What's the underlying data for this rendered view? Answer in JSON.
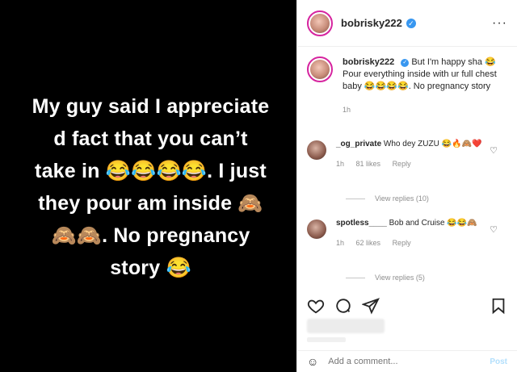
{
  "story": {
    "lines": [
      "My guy said I appreciate",
      "d fact that you can’t",
      "take in 😂😂😂😂. I just",
      "they pour am inside 🙈",
      "🙈🙈. No pregnancy",
      "story 😂"
    ]
  },
  "header": {
    "username": "bobrisky222",
    "verified_icon": "verified-badge-icon",
    "more_label": "···"
  },
  "caption": {
    "username": "bobrisky222",
    "text": "But I'm happy sha 😂 Pour everything inside with ur full chest baby 😂😂😂😂. No pregnancy story",
    "time": "1h"
  },
  "comments": [
    {
      "username": "_og_private",
      "text": "Who dey ZUZU 😂🔥🙈❤️",
      "time": "1h",
      "likes": "81 likes",
      "reply": "Reply",
      "view_replies": "View replies (10)"
    },
    {
      "username": "spotless____",
      "text": "Bob and Cruise 😂😂🙈",
      "time": "1h",
      "likes": "62 likes",
      "reply": "Reply",
      "view_replies": "View replies (5)"
    }
  ],
  "actions": {
    "like_icon": "heart-icon",
    "comment_icon": "comment-icon",
    "share_icon": "share-icon",
    "save_icon": "bookmark-icon"
  },
  "add_comment": {
    "emoji_icon": "emoji-icon",
    "placeholder": "Add a comment...",
    "post_label": "Post"
  },
  "colors": {
    "media_bg": "#000000",
    "verified": "#3897f0",
    "post_disabled": "#b2dffc"
  }
}
